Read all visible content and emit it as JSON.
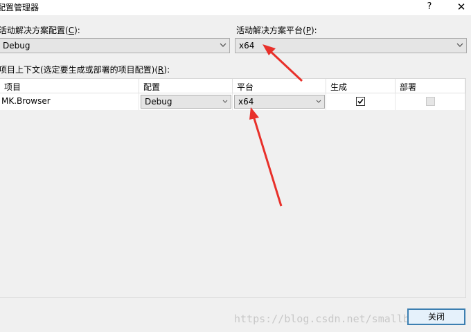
{
  "window": {
    "title": "配置管理器",
    "help": "?",
    "close": "✕"
  },
  "active_config": {
    "label_pre": "活动解决方案配置(",
    "label_key": "C",
    "label_post": "):",
    "value": "Debug"
  },
  "active_platform": {
    "label_pre": "活动解决方案平台(",
    "label_key": "P",
    "label_post": "):",
    "value": "x64"
  },
  "project_context": {
    "label_pre": "项目上下文(选定要生成或部署的项目配置)(",
    "label_key": "R",
    "label_post": "):"
  },
  "grid": {
    "columns": [
      "项目",
      "配置",
      "平台",
      "生成",
      "部署"
    ],
    "rows": [
      {
        "project": "MK.Browser",
        "config": "Debug",
        "platform": "x64",
        "build": true,
        "deploy": false
      }
    ]
  },
  "buttons": {
    "close": "关闭"
  },
  "watermark": "https://blog.csdn.net/smallbirdy"
}
